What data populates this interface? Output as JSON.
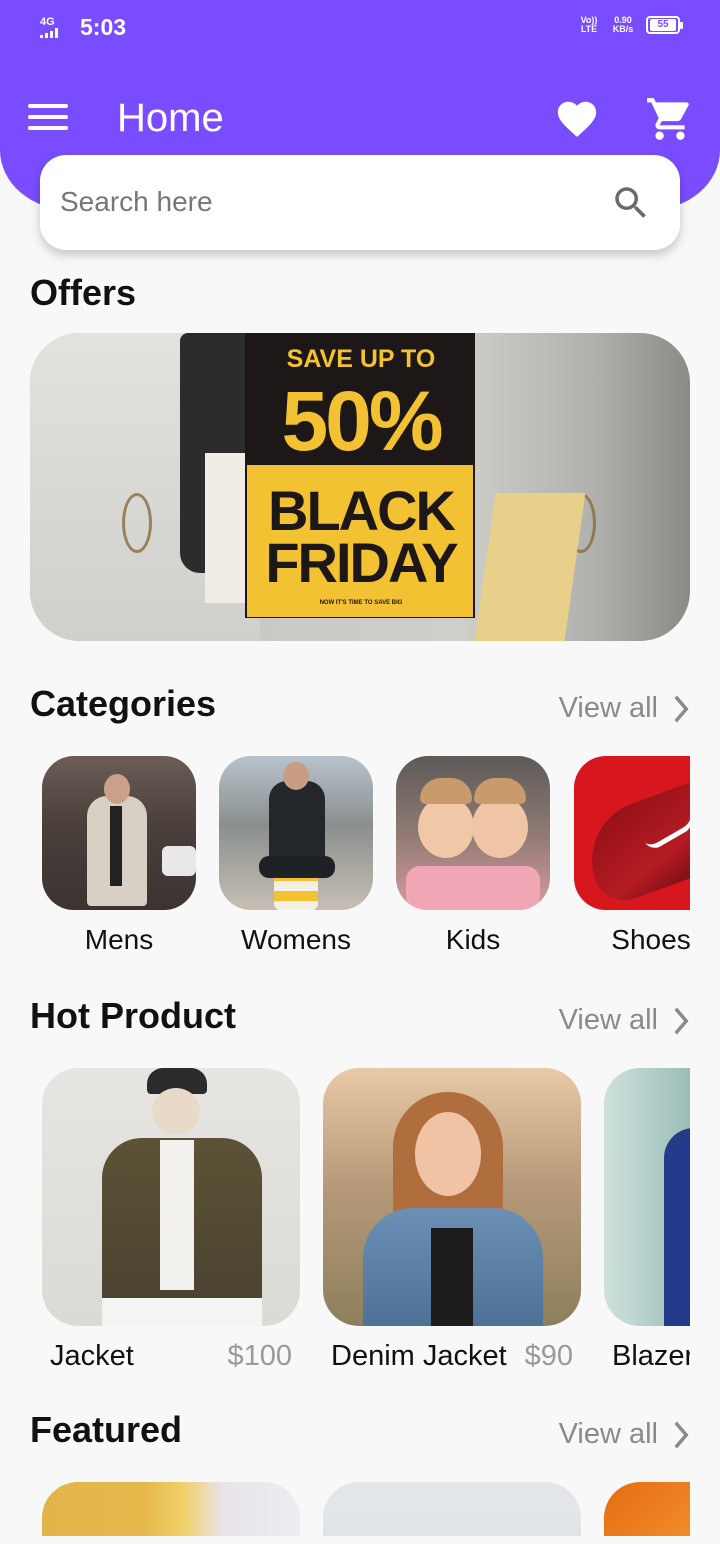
{
  "status_bar": {
    "network": "4G",
    "time": "5:03",
    "volte": "Vo)) LTE",
    "speed": "0.90 KB/s",
    "battery": "55"
  },
  "header": {
    "title": "Home"
  },
  "search": {
    "placeholder": "Search here"
  },
  "offers": {
    "title": "Offers",
    "banner": {
      "line1": "SAVE UP TO",
      "percent": "50%",
      "line2": "BLACK",
      "line3": "FRIDAY",
      "small": "NOW IT'S TIME TO SAVE BIG"
    }
  },
  "categories": {
    "title": "Categories",
    "view_all": "View all",
    "items": [
      {
        "label": "Mens"
      },
      {
        "label": "Womens"
      },
      {
        "label": "Kids"
      },
      {
        "label": "Shoes"
      }
    ]
  },
  "hot_product": {
    "title": "Hot Product",
    "view_all": "View all",
    "items": [
      {
        "name": "Jacket",
        "price": "$100"
      },
      {
        "name": "Denim Jacket",
        "price": "$90"
      },
      {
        "name": "Blazer",
        "price": ""
      }
    ]
  },
  "featured": {
    "title": "Featured",
    "view_all": "View all"
  },
  "colors": {
    "primary": "#7a4cff",
    "background": "#f8f8f8",
    "muted_text": "#8a8a8a"
  }
}
